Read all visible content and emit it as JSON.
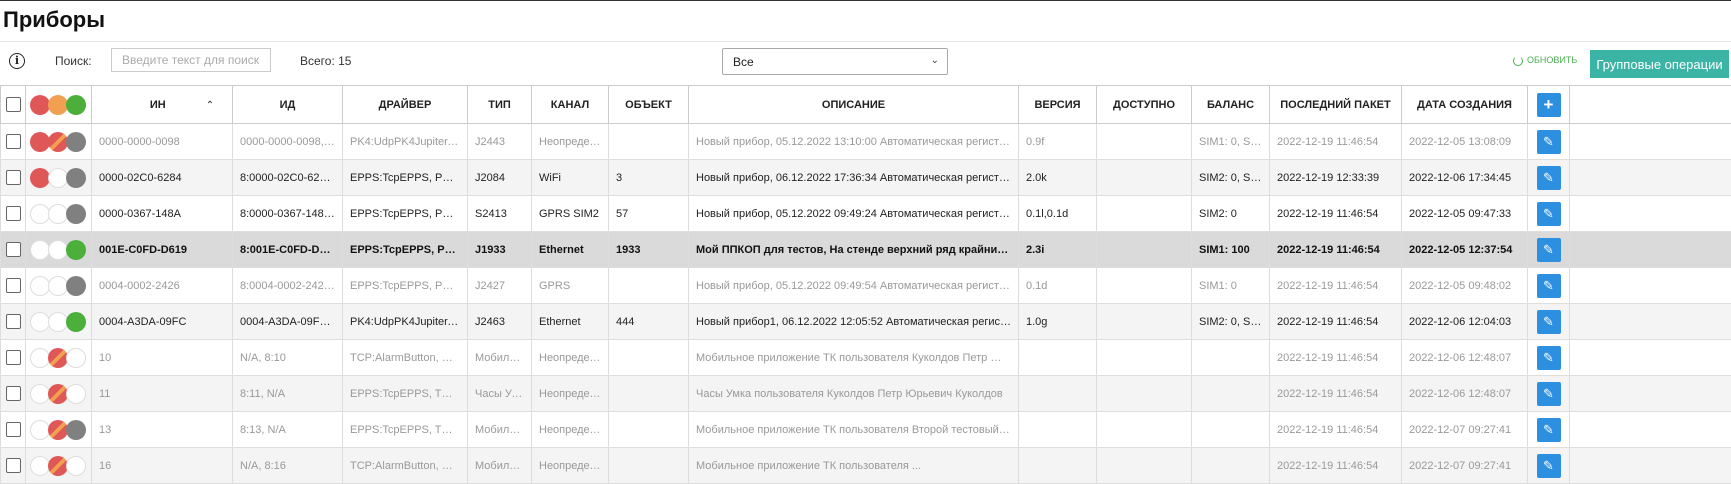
{
  "page": {
    "title": "Приборы"
  },
  "toolbar": {
    "search_label": "Поиск:",
    "search_placeholder": "Введите текст для поиска",
    "total_label": "Всего: 15",
    "filter_value": "Все",
    "refresh_label": "обновить",
    "group_ops_label": "Групповые операции"
  },
  "colors": {
    "red": "#e05757",
    "orange": "#f0a050",
    "green": "#4caf3c",
    "gray": "#808080",
    "white": "#ffffff",
    "teal": "#3bb4a5",
    "blue": "#2d8fe0"
  },
  "table": {
    "header_dots": [
      "red",
      "orange",
      "green"
    ],
    "columns": [
      "ИН",
      "ИД",
      "Драйвер",
      "Тип",
      "Канал",
      "Объект",
      "Описание",
      "Версия",
      "Доступно",
      "Баланс",
      "Последний пакет",
      "Дата создания"
    ],
    "rows": [
      {
        "style": "muted",
        "dots": [
          "red",
          "redorange",
          "gray"
        ],
        "in": "0000-0000-0098",
        "id": "0000-0000-0098, 8:0...",
        "driver": "PK4:UdpPK4Jupiter, EPP...",
        "type": "J2443",
        "channel": "Неопределен",
        "object": "",
        "description": "Новый прибор, 05.12.2022 13:10:00 Автоматическая регистрация в ...",
        "version": "0.9f",
        "available": "",
        "balance": "SIM1: 0, SIM2...",
        "last_packet": "2022-12-19 11:46:54",
        "created": "2022-12-05 13:08:09"
      },
      {
        "style": "",
        "dots": [
          "red",
          "white",
          "gray"
        ],
        "in": "0000-02C0-6284",
        "id": "8:0000-02C0-6284, 0...",
        "driver": "EPPS:TcpEPPS, PK4:Udp...",
        "type": "J2084",
        "channel": "WiFi",
        "object": "3",
        "description": "Новый прибор, 06.12.2022 17:36:34 Автоматическая регистрация в ...",
        "version": "2.0k",
        "available": "",
        "balance": "SIM2: 0, SIM1...",
        "last_packet": "2022-12-19 12:33:39",
        "created": "2022-12-06 17:34:45"
      },
      {
        "style": "",
        "dots": [
          "white",
          "white",
          "gray"
        ],
        "in": "0000-0367-148A",
        "id": "8:0000-0367-148A, 0...",
        "driver": "EPPS:TcpEPPS, PK4:Udp...",
        "type": "S2413",
        "channel": "GPRS SIM2",
        "object": "57",
        "description": "Новый прибор, 05.12.2022 09:49:24 Автоматическая регистрация в ...",
        "version": "0.1l,0.1d",
        "available": "",
        "balance": "SIM2: 0",
        "last_packet": "2022-12-19 11:46:54",
        "created": "2022-12-05 09:47:33"
      },
      {
        "style": "selected",
        "dots": [
          "white",
          "white",
          "green"
        ],
        "in": "001E-C0FD-D619",
        "id": "8:001E-C0FD-D619, ...",
        "driver": "EPPS:TcpEPPS, PK4:Ud...",
        "type": "J1933",
        "channel": "Ethernet",
        "object": "1933",
        "description": "Мой ППКОП для тестов, На стенде верхний ряд крайний слева",
        "version": "2.3i",
        "available": "",
        "balance": "SIM1: 100",
        "last_packet": "2022-12-19 11:46:54",
        "created": "2022-12-05 12:37:54"
      },
      {
        "style": "muted",
        "dots": [
          "white",
          "white",
          "gray"
        ],
        "in": "0004-0002-2426",
        "id": "8:0004-0002-2426, 0...",
        "driver": "EPPS:TcpEPPS, PK4:Udp...",
        "type": "J2427",
        "channel": "GPRS",
        "object": "",
        "description": "Новый прибор, 05.12.2022 09:49:54 Автоматическая регистрация в ...",
        "version": "0.1d",
        "available": "",
        "balance": "SIM1: 0",
        "last_packet": "2022-12-19 11:46:54",
        "created": "2022-12-05 09:48:02"
      },
      {
        "style": "",
        "dots": [
          "white",
          "white",
          "green"
        ],
        "in": "0004-A3DA-09FC",
        "id": "0004-A3DA-09FC, 8:...",
        "driver": "PK4:UdpPK4Jupiter, EPP...",
        "type": "J2463",
        "channel": "Ethernet",
        "object": "444",
        "description": "Новый прибор1, 06.12.2022 12:05:52 Автоматическая регистрация ...",
        "version": "1.0g",
        "available": "",
        "balance": "SIM2: 0, SIM1...",
        "last_packet": "2022-12-19 11:46:54",
        "created": "2022-12-06 12:04:03"
      },
      {
        "style": "muted",
        "dots": [
          "white",
          "redorange",
          "white"
        ],
        "in": "10",
        "id": "N/A, 8:10",
        "driver": "TCP:AlarmButton, EPPS:...",
        "type": "Мобильн...",
        "channel": "Неопределен",
        "object": "",
        "description": "Мобильное приложение ТК пользователя Куколдов Петр Юрьеви...",
        "version": "",
        "available": "",
        "balance": "",
        "last_packet": "2022-12-19 11:46:54",
        "created": "2022-12-06 12:48:07"
      },
      {
        "style": "muted",
        "dots": [
          "white",
          "redorange",
          "white"
        ],
        "in": "11",
        "id": "8:11, N/A",
        "driver": "EPPS:TcpEPPS, TCP:Um...",
        "type": "Часы Умка",
        "channel": "Неопределен",
        "object": "",
        "description": "Часы Умка пользователя Куколдов Петр Юрьевич Куколдов",
        "version": "",
        "available": "",
        "balance": "",
        "last_packet": "2022-12-19 11:46:54",
        "created": "2022-12-06 12:48:07"
      },
      {
        "style": "muted",
        "dots": [
          "white",
          "redorange",
          "gray"
        ],
        "in": "13",
        "id": "8:13, N/A",
        "driver": "EPPS:TcpEPPS, TCP:Alar...",
        "type": "Мобильн...",
        "channel": "Неопределен",
        "object": "",
        "description": "Мобильное приложение ТК пользователя Второй тестовый ХО для...",
        "version": "",
        "available": "",
        "balance": "",
        "last_packet": "2022-12-19 11:46:54",
        "created": "2022-12-07 09:27:41"
      },
      {
        "style": "muted",
        "dots": [
          "white",
          "redorange",
          "white"
        ],
        "in": "16",
        "id": "N/A, 8:16",
        "driver": "TCP:AlarmButton, EPPS:...",
        "type": "Мобильн...",
        "channel": "Неопределен",
        "object": "",
        "description": "Мобильное приложение ТК пользователя ...",
        "version": "",
        "available": "",
        "balance": "",
        "last_packet": "2022-12-19 11:46:54",
        "created": "2022-12-07 09:27:41"
      }
    ]
  }
}
